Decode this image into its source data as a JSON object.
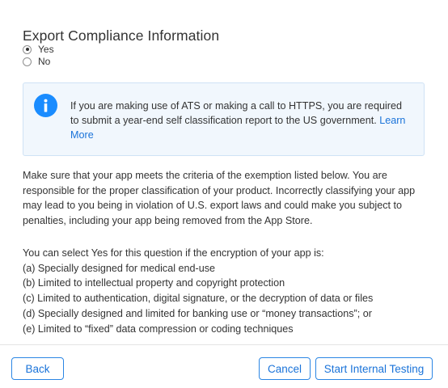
{
  "dialog": {
    "title": "Export Compliance Information",
    "options": [
      {
        "label": "Yes",
        "selected": true
      },
      {
        "label": "No",
        "selected": false
      }
    ],
    "info": {
      "icon": "info-icon",
      "text": "If you are making use of ATS or making a call to HTTPS, you are required to submit a year-end self classification report to the US government.",
      "link": "Learn More"
    },
    "paragraph": "Make sure that your app meets the criteria of the exemption listed below. You are responsible for the proper classification of your product. Incorrectly classifying your app may lead to you being in violation of U.S. export laws and could make you subject to penalties, including your app being removed from the App Store.",
    "criteria_intro": "You can select Yes for this question if the encryption of your app is:",
    "criteria": [
      "(a) Specially designed for medical end-use",
      "(b) Limited to intellectual property and copyright protection",
      "(c) Limited to authentication, digital signature, or the decryption of data or files",
      "(d) Specially designed and limited for banking use or “money transactions”; or",
      "(e) Limited to “fixed” data compression or coding techniques"
    ]
  },
  "footer": {
    "back_label": "Back",
    "cancel_label": "Cancel",
    "start_label": "Start Internal Testing"
  },
  "colors": {
    "accent": "#1a73d9",
    "info_bg": "#f1f7fd",
    "info_icon": "#1a8cff"
  }
}
